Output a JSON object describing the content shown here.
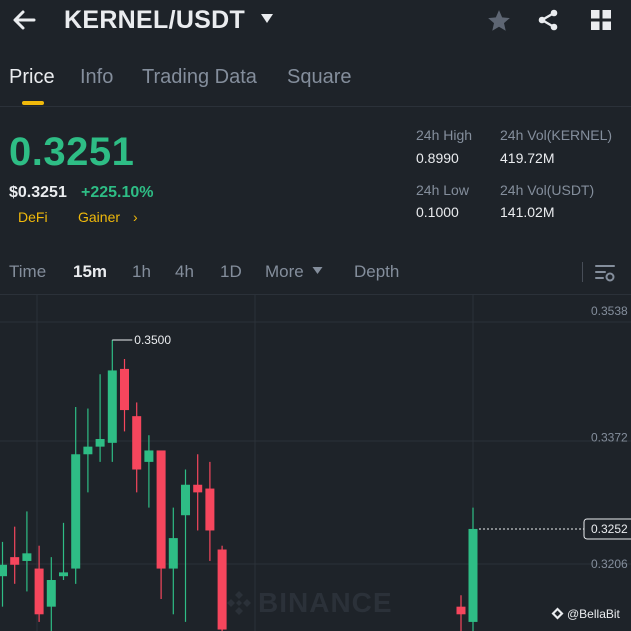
{
  "header": {
    "pair": "KERNEL/USDT",
    "icons": [
      "back-arrow-icon",
      "chevron-down-icon",
      "star-icon",
      "share-icon",
      "grid-icon"
    ]
  },
  "tabs": [
    {
      "label": "Price",
      "active": true
    },
    {
      "label": "Info",
      "active": false
    },
    {
      "label": "Trading Data",
      "active": false
    },
    {
      "label": "Square",
      "active": false
    }
  ],
  "price": {
    "last": "0.3251",
    "usd": "$0.3251",
    "change": "+225.10%",
    "tags": [
      "DeFi",
      "Gainer"
    ],
    "tag_caret": "›"
  },
  "stats": {
    "high_label": "24h High",
    "high_value": "0.8990",
    "low_label": "24h Low",
    "low_value": "0.1000",
    "vol_base_label": "24h Vol(KERNEL)",
    "vol_base_value": "419.72M",
    "vol_quote_label": "24h Vol(USDT)",
    "vol_quote_value": "141.02M"
  },
  "intervals": [
    {
      "label": "Time",
      "active": false
    },
    {
      "label": "15m",
      "active": true
    },
    {
      "label": "1h",
      "active": false
    },
    {
      "label": "4h",
      "active": false
    },
    {
      "label": "1D",
      "active": false
    },
    {
      "label": "More",
      "active": false
    },
    {
      "label": "Depth",
      "active": false
    }
  ],
  "chart_data": {
    "type": "candlestick",
    "y_axis_labels": [
      "0.3538",
      "0.3372",
      "0.3206"
    ],
    "current_price_label": "0.3252",
    "high_marker_label": "0.3500",
    "watermark": "BINANCE",
    "credit": "@BellaBit",
    "colors": {
      "up": "#2ebd85",
      "down": "#f6465d",
      "grid": "#2b3139"
    },
    "candles": [
      {
        "o": 0.319,
        "h": 0.3235,
        "l": 0.315,
        "c": 0.3205
      },
      {
        "o": 0.3215,
        "h": 0.3255,
        "l": 0.318,
        "c": 0.3205
      },
      {
        "o": 0.321,
        "h": 0.3275,
        "l": 0.317,
        "c": 0.322
      },
      {
        "o": 0.32,
        "h": 0.323,
        "l": 0.313,
        "c": 0.314
      },
      {
        "o": 0.315,
        "h": 0.3215,
        "l": 0.311,
        "c": 0.3185
      },
      {
        "o": 0.319,
        "h": 0.326,
        "l": 0.3185,
        "c": 0.3195
      },
      {
        "o": 0.32,
        "h": 0.3412,
        "l": 0.318,
        "c": 0.335
      },
      {
        "o": 0.335,
        "h": 0.341,
        "l": 0.33,
        "c": 0.336
      },
      {
        "o": 0.336,
        "h": 0.3455,
        "l": 0.334,
        "c": 0.337
      },
      {
        "o": 0.3365,
        "h": 0.35,
        "l": 0.334,
        "c": 0.346
      },
      {
        "o": 0.3462,
        "h": 0.3475,
        "l": 0.338,
        "c": 0.3408
      },
      {
        "o": 0.34,
        "h": 0.3418,
        "l": 0.33,
        "c": 0.333
      },
      {
        "o": 0.334,
        "h": 0.3375,
        "l": 0.328,
        "c": 0.3355
      },
      {
        "o": 0.3355,
        "h": 0.335,
        "l": 0.316,
        "c": 0.32
      },
      {
        "o": 0.32,
        "h": 0.328,
        "l": 0.314,
        "c": 0.324
      },
      {
        "o": 0.327,
        "h": 0.333,
        "l": 0.313,
        "c": 0.331
      },
      {
        "o": 0.331,
        "h": 0.335,
        "l": 0.325,
        "c": 0.33
      },
      {
        "o": 0.3305,
        "h": 0.334,
        "l": 0.321,
        "c": 0.325
      },
      {
        "o": 0.3225,
        "h": 0.323,
        "l": 0.31,
        "c": 0.312
      },
      {
        "o": 0.315,
        "h": 0.3165,
        "l": 0.311,
        "c": 0.314
      },
      {
        "o": 0.313,
        "h": 0.328,
        "l": 0.31,
        "c": 0.3252
      }
    ]
  }
}
